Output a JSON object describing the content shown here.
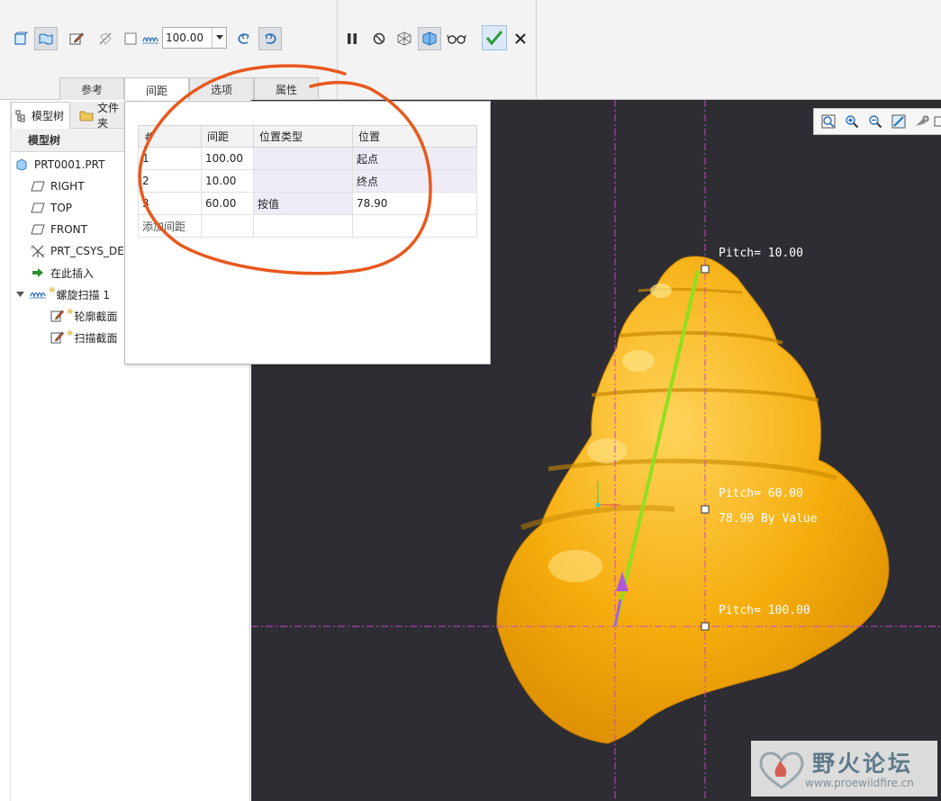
{
  "ribbon": {
    "pitch_value": "100.00",
    "tabs": [
      {
        "label": "参考"
      },
      {
        "label": "间距"
      },
      {
        "label": "选项"
      },
      {
        "label": "属性"
      }
    ]
  },
  "left_panel": {
    "tabs": [
      {
        "label": "模型树"
      },
      {
        "label": "文件夹"
      }
    ],
    "tree_header": "模型树",
    "tree": [
      {
        "label": "PRT0001.PRT",
        "icon": "part-icon"
      },
      {
        "label": "RIGHT",
        "icon": "datum-plane-icon"
      },
      {
        "label": "TOP",
        "icon": "datum-plane-icon"
      },
      {
        "label": "FRONT",
        "icon": "datum-plane-icon"
      },
      {
        "label": "PRT_CSYS_DEF",
        "icon": "csys-icon"
      },
      {
        "label": "在此插入",
        "icon": "insert-arrow-icon"
      },
      {
        "label": "螺旋扫描 1",
        "icon": "helical-sweep-icon"
      },
      {
        "label": "轮廓截面",
        "icon": "sketch-icon"
      },
      {
        "label": "扫描截面",
        "icon": "sketch-icon"
      }
    ]
  },
  "pitch_table": {
    "headers": [
      "#",
      "间距",
      "位置类型",
      "位置"
    ],
    "rows": [
      {
        "index": "1",
        "pitch": "100.00",
        "type": "",
        "position": "起点"
      },
      {
        "index": "2",
        "pitch": "10.00",
        "type": "",
        "position": "终点"
      },
      {
        "index": "3",
        "pitch": "60.00",
        "type": "按值",
        "position": "78.90"
      }
    ],
    "add_row_label": "添加间距"
  },
  "viewport": {
    "annotations": [
      {
        "text": "Pitch= 10.00"
      },
      {
        "text": "Pitch= 60.00"
      },
      {
        "text": "78.90 By Value"
      },
      {
        "text": "Pitch= 100.00"
      }
    ]
  },
  "watermark": {
    "title": "野火论坛",
    "url": "www.proewildfire.cn"
  },
  "colors": {
    "shell": "#f5ad0d",
    "axis": "#cc44cc",
    "trajectory": "#8fdf20",
    "start_arrow": "#b15ad8",
    "annotation": "#ffffff",
    "highlight_ring": "#e8581e",
    "viewport_bg": "#2d2d33",
    "confirm": "#2c9c3c"
  }
}
